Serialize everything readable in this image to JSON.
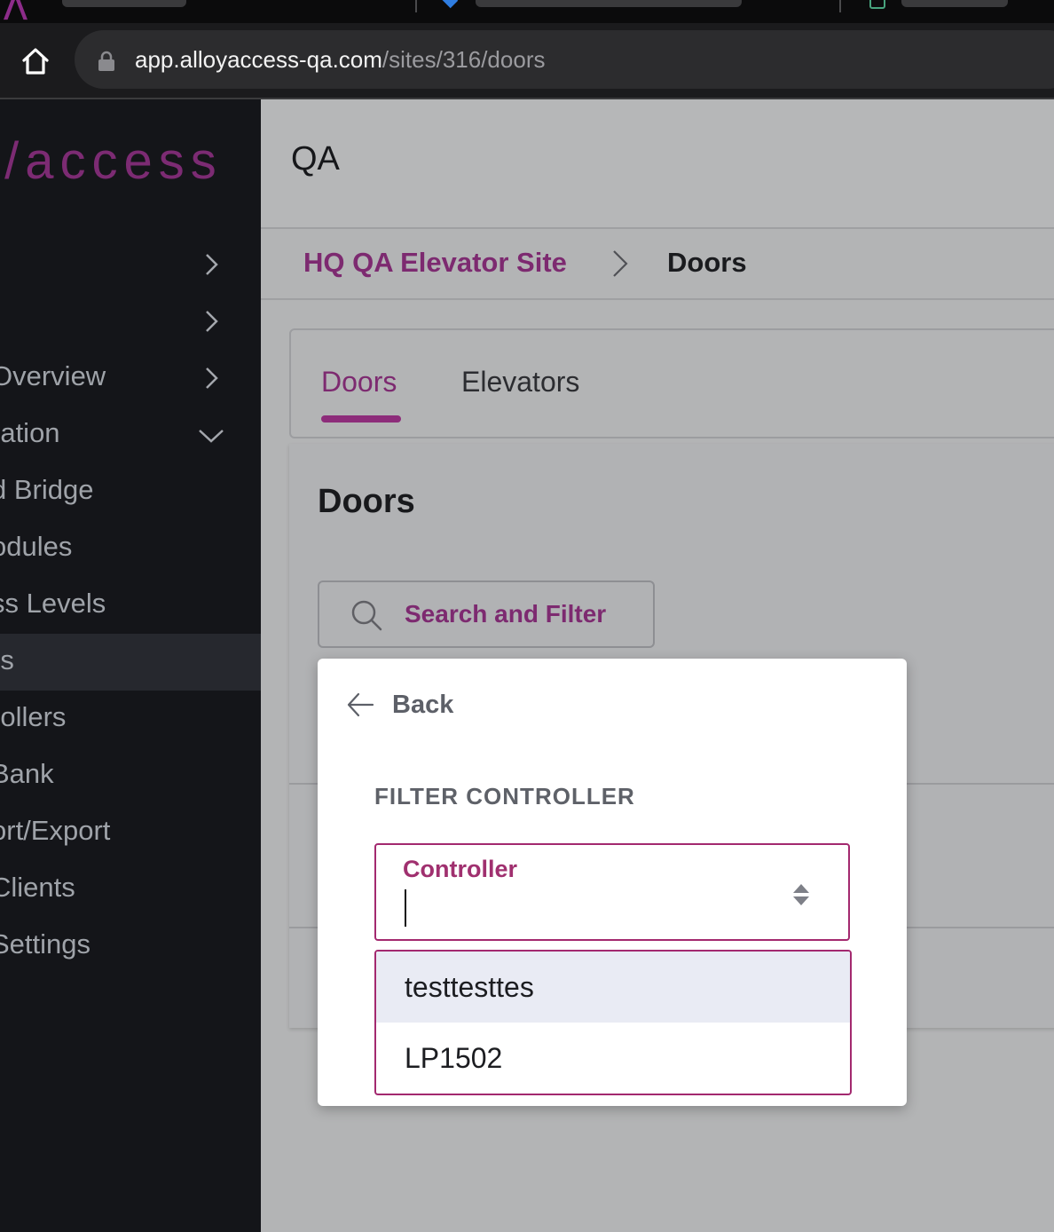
{
  "browser": {
    "url_host": "app.alloyaccess-qa.com",
    "url_path": "/sites/316/doors"
  },
  "sidebar": {
    "brand": "//access",
    "items": [
      {
        "label": "",
        "chevron": "right"
      },
      {
        "label": "",
        "chevron": "right"
      },
      {
        "label": "Overview",
        "chevron": "right"
      },
      {
        "label": "ration",
        "chevron": "down"
      },
      {
        "label": "d Bridge"
      },
      {
        "label": "odules"
      },
      {
        "label": "ss Levels"
      },
      {
        "label": "rs",
        "active": true
      },
      {
        "label": "rollers"
      },
      {
        "label": " Bank"
      },
      {
        "label": "ort/Export"
      },
      {
        "label": "Clients"
      },
      {
        "label": "Settings"
      }
    ]
  },
  "header": {
    "title": "QA"
  },
  "breadcrumb": {
    "site": "HQ QA Elevator Site",
    "current": "Doors"
  },
  "tabs": {
    "doors": "Doors",
    "elevators": "Elevators"
  },
  "content": {
    "title": "Doors",
    "search_label": "Search and Filter"
  },
  "filter_popover": {
    "back_label": "Back",
    "heading": "FILTER CONTROLLER",
    "select_label": "Controller",
    "select_value": "",
    "options": [
      "testtesttes",
      "LP1502"
    ],
    "highlighted_index": 0
  },
  "colors": {
    "accent": "#7d2a70",
    "focus_border": "#a3296f",
    "sidebar_bg": "#141519",
    "overlay_bg": "#b3b4b5",
    "option_highlight": "#e9ebf4"
  },
  "icons": [
    "home-icon",
    "lock-icon",
    "chevron-right-icon",
    "chevron-down-icon",
    "search-icon",
    "arrow-left-icon",
    "sort-updown-icon"
  ]
}
